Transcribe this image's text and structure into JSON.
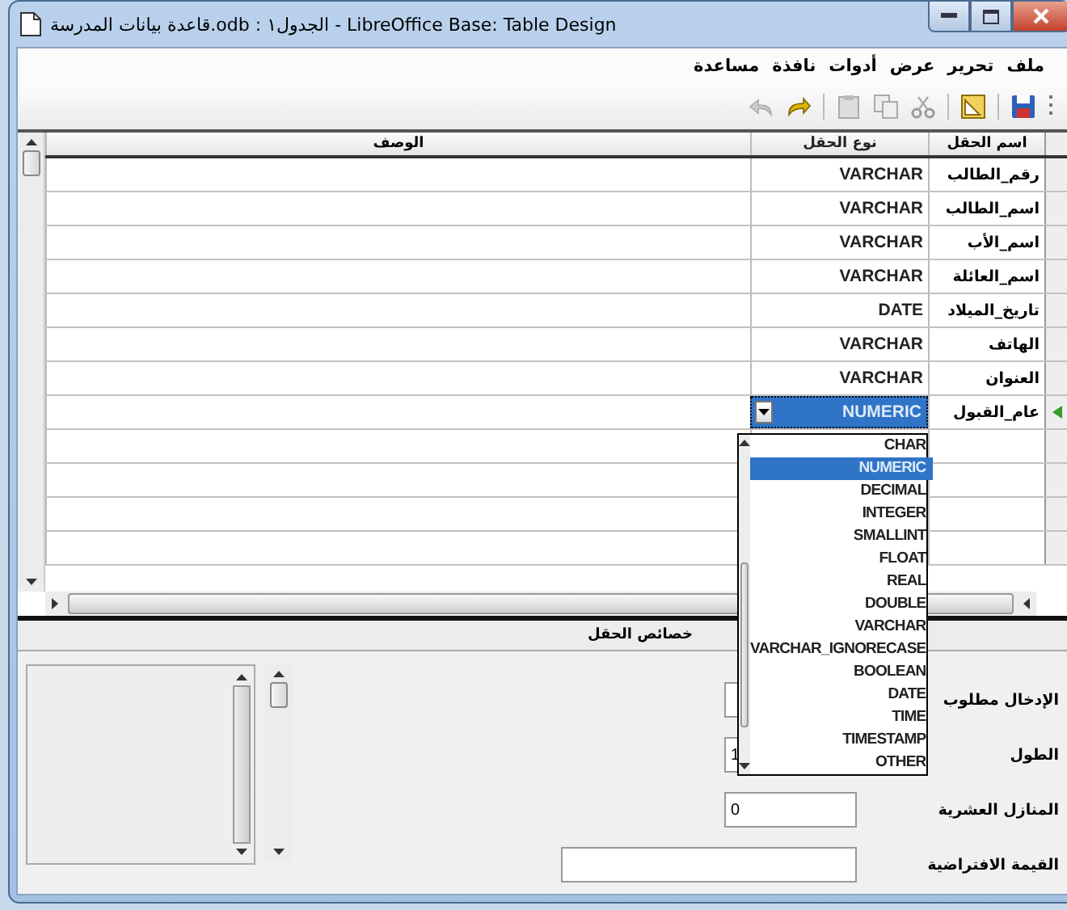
{
  "window": {
    "title": "قاعدة بيانات المدرسة.odb : الجدول١ - LibreOffice Base: Table Design"
  },
  "menu": [
    {
      "label": "ملف"
    },
    {
      "label": "تحرير"
    },
    {
      "label": "عرض"
    },
    {
      "label": "أدوات"
    },
    {
      "label": "نافذة"
    },
    {
      "label": "مساعدة"
    }
  ],
  "table": {
    "columns": [
      "اسم الحقل",
      "نوع الحقل",
      "الوصف"
    ],
    "rows": [
      {
        "name": "رقم_الطالب",
        "type": "VARCHAR",
        "selected": false
      },
      {
        "name": "اسم_الطالب",
        "type": "VARCHAR",
        "selected": false
      },
      {
        "name": "اسم_الأب",
        "type": "VARCHAR",
        "selected": false
      },
      {
        "name": "اسم_العائلة",
        "type": "VARCHAR",
        "selected": false
      },
      {
        "name": "تاريخ_الميلاد",
        "type": "DATE",
        "selected": false
      },
      {
        "name": "الهاتف",
        "type": "VARCHAR",
        "selected": false
      },
      {
        "name": "العنوان",
        "type": "VARCHAR",
        "selected": false
      },
      {
        "name": "عام_القبول",
        "type": "NUMERIC",
        "selected": true
      }
    ]
  },
  "type_dropdown": {
    "expanded": true,
    "options": [
      {
        "label": "CHAR",
        "selected": false
      },
      {
        "label": "NUMERIC",
        "selected": true
      },
      {
        "label": "DECIMAL",
        "selected": false
      },
      {
        "label": "INTEGER",
        "selected": false
      },
      {
        "label": "SMALLINT",
        "selected": false
      },
      {
        "label": "FLOAT",
        "selected": false
      },
      {
        "label": "REAL",
        "selected": false
      },
      {
        "label": "DOUBLE",
        "selected": false
      },
      {
        "label": "VARCHAR",
        "selected": false
      },
      {
        "label": "VARCHAR_IGNORECASE",
        "selected": false
      },
      {
        "label": "BOOLEAN",
        "selected": false
      },
      {
        "label": "DATE",
        "selected": false
      },
      {
        "label": "TIME",
        "selected": false
      },
      {
        "label": "TIMESTAMP",
        "selected": false
      },
      {
        "label": "OTHER",
        "selected": false
      }
    ]
  },
  "field_properties": {
    "title": "خصائص الحقل",
    "items": [
      {
        "label": "الإدخال مطلوب",
        "kind": "dropdown"
      },
      {
        "label": "الطول",
        "kind": "field",
        "value": "1"
      },
      {
        "label": "المنازل العشرية",
        "kind": "field",
        "value": "0"
      },
      {
        "label": "القيمة الافتراضية",
        "kind": "wide-field"
      }
    ]
  }
}
